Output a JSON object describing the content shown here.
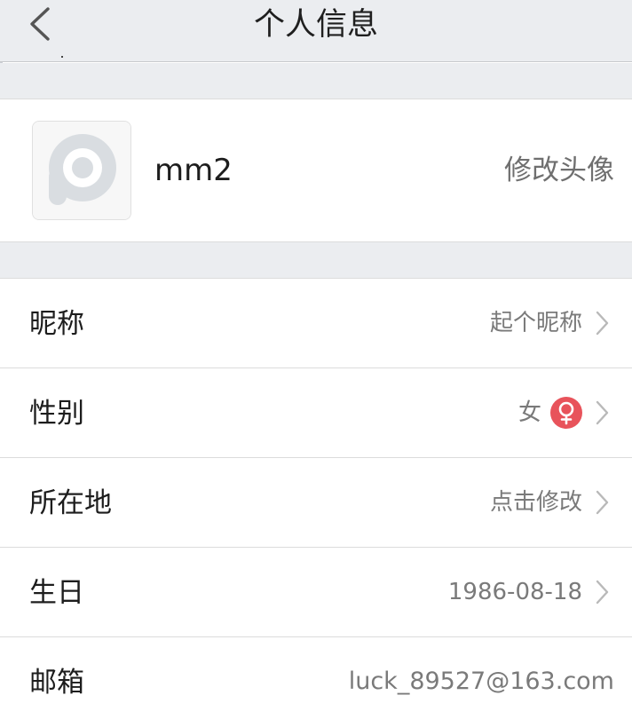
{
  "header": {
    "title": "个人信息",
    "back_icon": "chevron-left-icon"
  },
  "profile": {
    "username": "mm2",
    "change_avatar_label": "修改头像",
    "avatar_icon": "default-avatar-icon"
  },
  "rows": [
    {
      "label": "昵称",
      "value": "起个昵称",
      "chevron": true
    },
    {
      "label": "性别",
      "value": "女",
      "icon": "female-icon",
      "icon_color": "#e8535b",
      "chevron": true
    },
    {
      "label": "所在地",
      "value": "点击修改",
      "chevron": true
    },
    {
      "label": "生日",
      "value": "1986-08-18",
      "chevron": true
    },
    {
      "label": "邮箱",
      "value": "luck_89527@163.com",
      "chevron": false
    }
  ],
  "colors": {
    "header_bg": "#ebedf0",
    "section_gap": "#ebedf0",
    "divider": "#dcdcdc",
    "secondary_text": "#7a7a7a",
    "female_accent": "#e8535b"
  }
}
